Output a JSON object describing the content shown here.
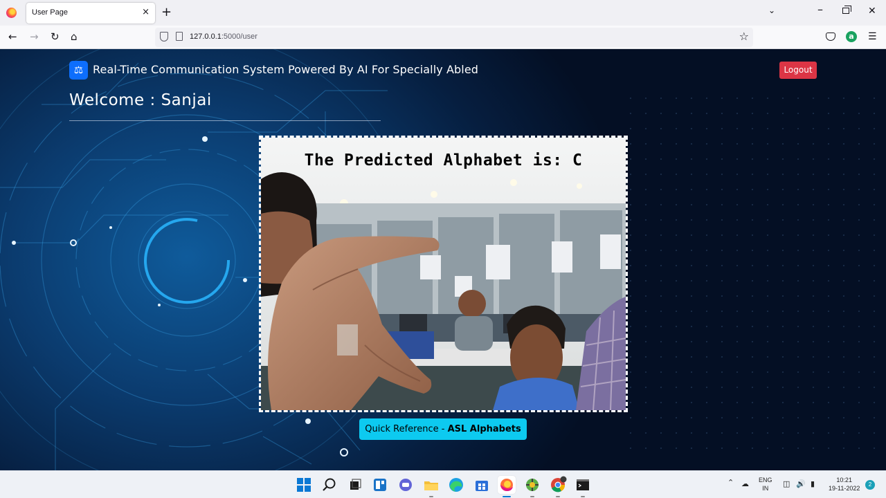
{
  "browser": {
    "tab_title": "User Page",
    "tab_close": "×",
    "new_tab": "+",
    "url_host": "127.0.0.1",
    "url_path": ":5000/user",
    "icons": [
      "firefox-logo",
      "back-arrow",
      "forward-arrow",
      "reload",
      "home",
      "shield",
      "page",
      "bookmark-star",
      "pocket",
      "extension",
      "menu"
    ]
  },
  "app": {
    "brand_title": "Real-Time Communication System Powered By AI For Specially Abled",
    "logout_label": "Logout",
    "welcome_text": "Welcome : Sanjai",
    "prediction_text": "The Predicted Alphabet is: C",
    "quick_reference_prefix": "Quick Reference - ",
    "quick_reference_bold": "ASL Alphabets",
    "colors": {
      "primary": "#0d6efd",
      "danger": "#dc3545",
      "info": "#0dcaf0"
    }
  },
  "taskbar": {
    "lang_top": "ENG",
    "lang_bottom": "IN",
    "time": "10:21",
    "date": "19-11-2022",
    "notification_count": "2",
    "apps": [
      "start",
      "search",
      "task-view",
      "widgets",
      "chat",
      "file-explorer",
      "edge",
      "store",
      "firefox",
      "network-app",
      "chrome",
      "terminal"
    ]
  }
}
